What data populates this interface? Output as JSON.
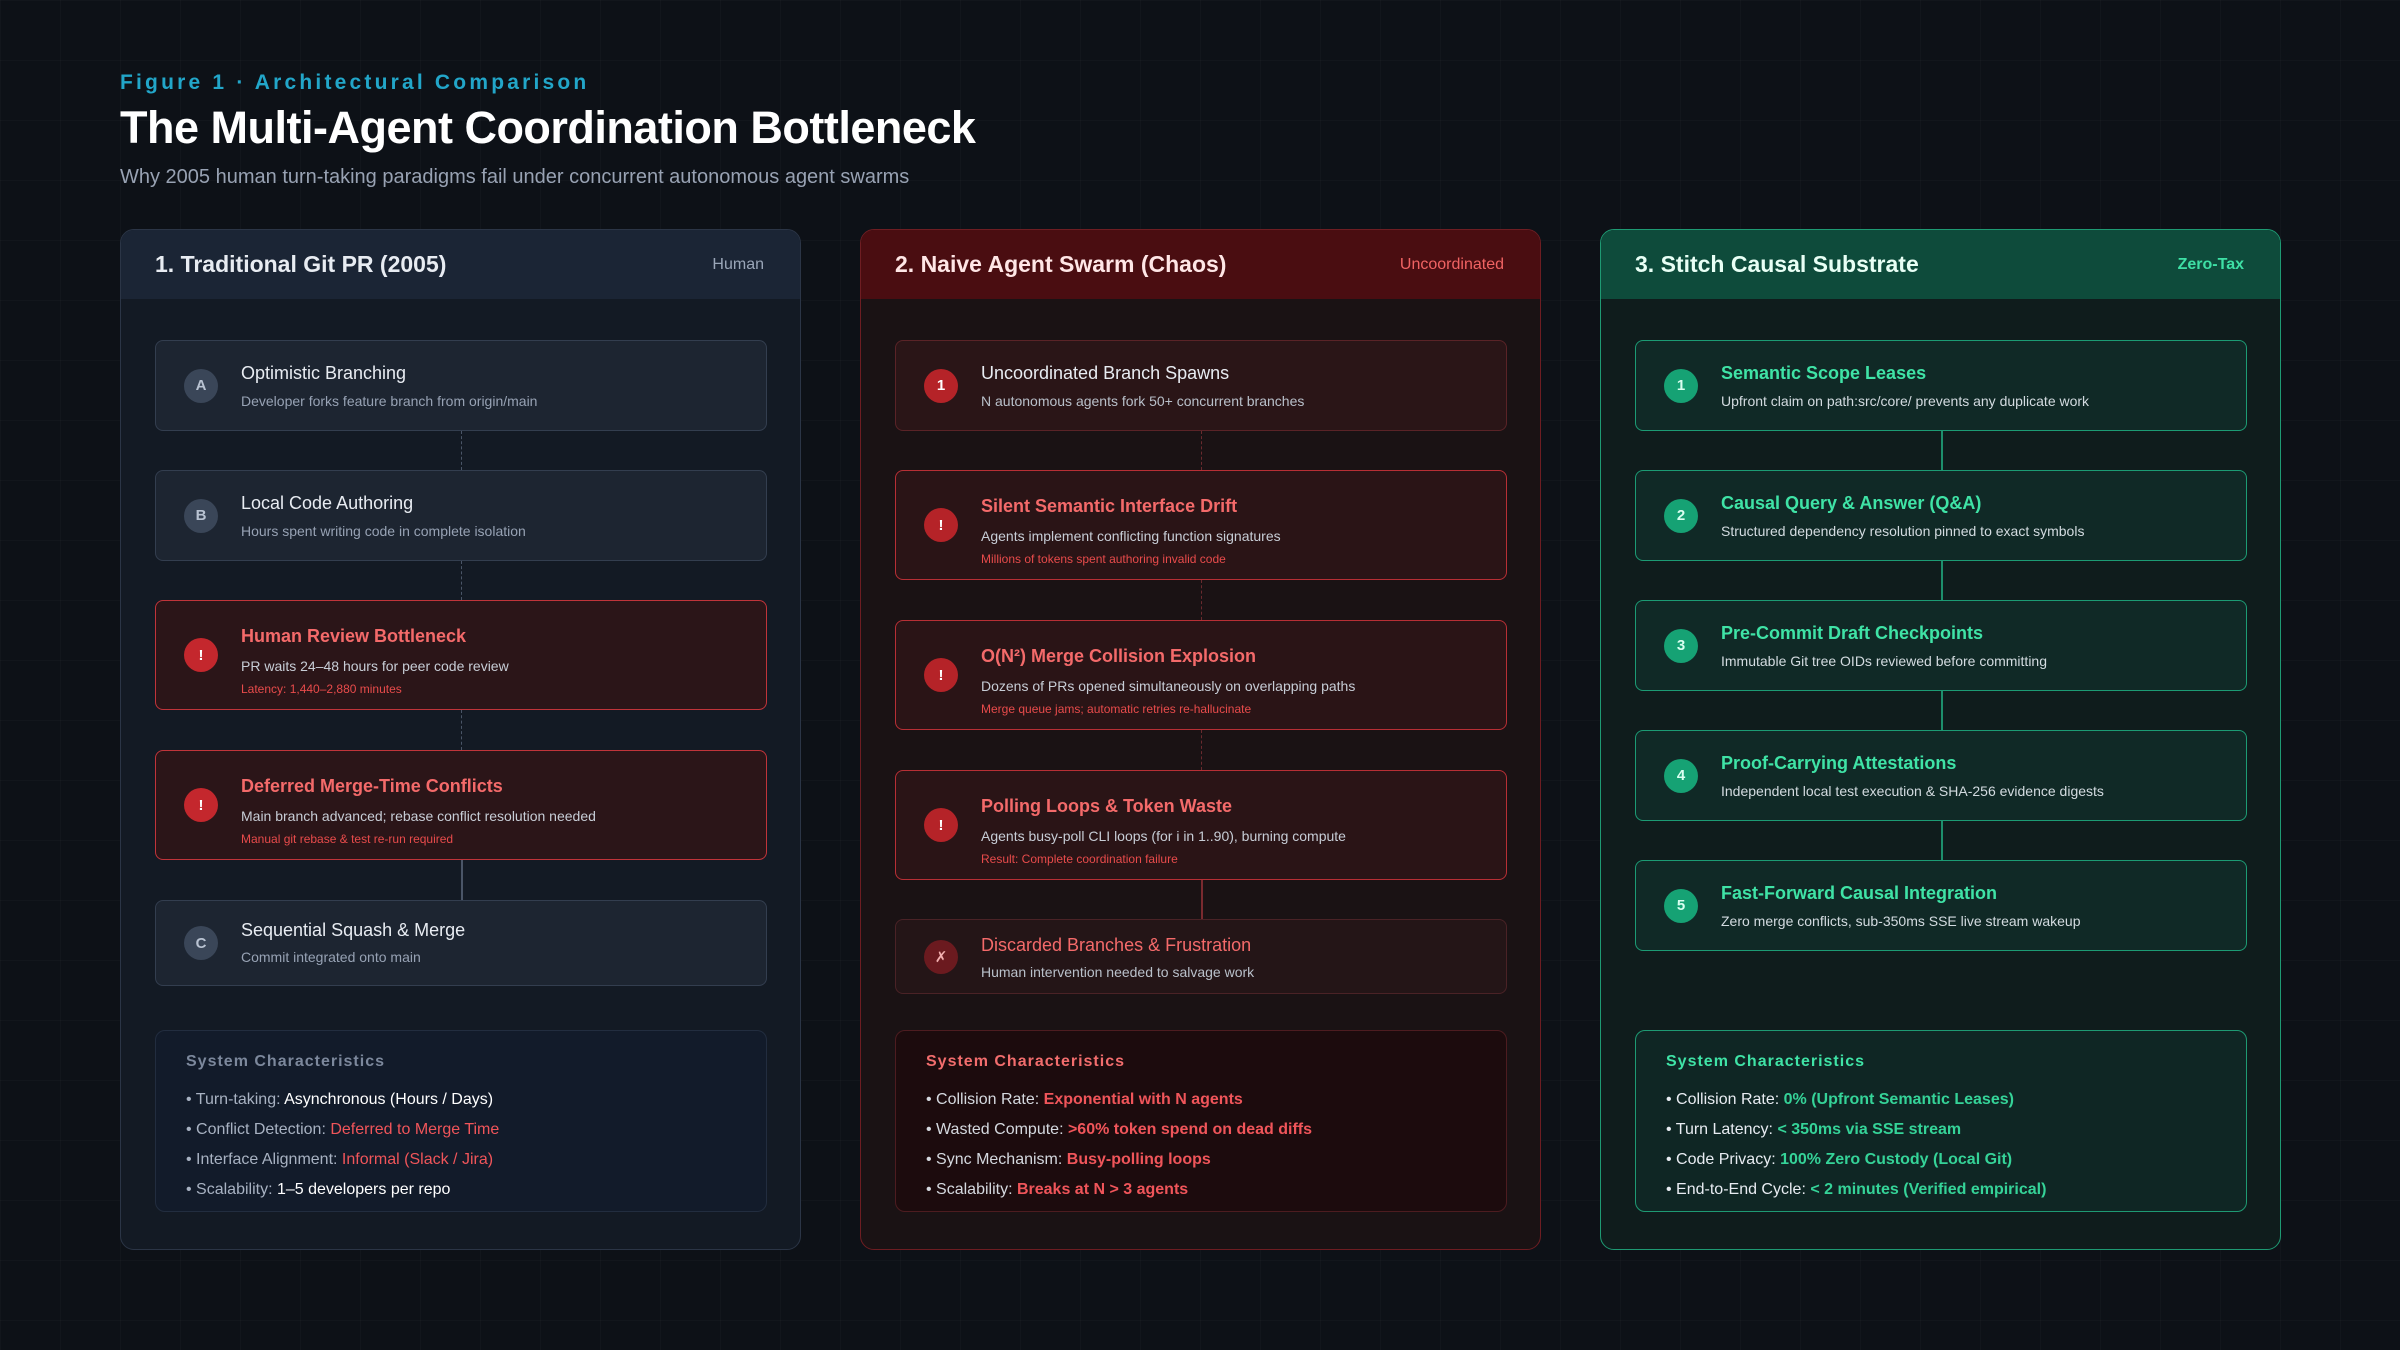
{
  "header": {
    "eyebrow": "Figure 1 · Architectural Comparison",
    "title": "The Multi-Agent Coordination Bottleneck",
    "subtitle": "Why 2005 human turn-taking paradigms fail under concurrent autonomous agent swarms"
  },
  "colors": {
    "accent_cyan": "#22a6c9",
    "alert_red": "#f0555a",
    "success_green": "#35d398"
  },
  "columns": [
    {
      "title": "1. Traditional Git PR (2005)",
      "tag": "Human",
      "steps": [
        {
          "badge": "A",
          "title": "Optimistic Branching",
          "desc": "Developer forks feature branch from origin/main",
          "note": ""
        },
        {
          "badge": "B",
          "title": "Local Code Authoring",
          "desc": "Hours spent writing code in complete isolation",
          "note": ""
        },
        {
          "badge": "!",
          "title": "Human Review Bottleneck",
          "desc": "PR waits 24–48 hours for peer code review",
          "note": "Latency: 1,440–2,880 minutes"
        },
        {
          "badge": "!",
          "title": "Deferred Merge-Time Conflicts",
          "desc": "Main branch advanced; rebase conflict resolution needed",
          "note": "Manual git rebase & test re-run required"
        },
        {
          "badge": "C",
          "title": "Sequential Squash & Merge",
          "desc": "Commit integrated onto main",
          "note": ""
        }
      ],
      "system": {
        "title": "System Characteristics",
        "rows": [
          {
            "label": "• Turn-taking: ",
            "value": "Asynchronous (Hours / Days)"
          },
          {
            "label": "• Conflict Detection: ",
            "value": "Deferred to Merge Time"
          },
          {
            "label": "• Interface Alignment: ",
            "value": "Informal (Slack / Jira)"
          },
          {
            "label": "• Scalability: ",
            "value": "1–5 developers per repo"
          }
        ]
      }
    },
    {
      "title": "2. Naive Agent Swarm (Chaos)",
      "tag": "Uncoordinated",
      "steps": [
        {
          "badge": "1",
          "title": "Uncoordinated Branch Spawns",
          "desc": "N autonomous agents fork 50+ concurrent branches",
          "note": ""
        },
        {
          "badge": "!",
          "title": "Silent Semantic Interface Drift",
          "desc": "Agents implement conflicting function signatures",
          "note": "Millions of tokens spent authoring invalid code"
        },
        {
          "badge": "!",
          "title": "O(N²) Merge Collision Explosion",
          "desc": "Dozens of PRs opened simultaneously on overlapping paths",
          "note": "Merge queue jams; automatic retries re-hallucinate"
        },
        {
          "badge": "!",
          "title": "Polling Loops & Token Waste",
          "desc": "Agents busy-poll CLI loops (for i in 1..90), burning compute",
          "note": "Result: Complete coordination failure"
        },
        {
          "badge": "✗",
          "title": "Discarded Branches & Frustration",
          "desc": "Human intervention needed to salvage work",
          "note": ""
        }
      ],
      "system": {
        "title": "System Characteristics",
        "rows": [
          {
            "label": "• Collision Rate: ",
            "value": "Exponential with N agents"
          },
          {
            "label": "• Wasted Compute: ",
            "value": ">60% token spend on dead diffs"
          },
          {
            "label": "• Sync Mechanism: ",
            "value": "Busy-polling loops"
          },
          {
            "label": "• Scalability: ",
            "value": "Breaks at N > 3 agents"
          }
        ]
      }
    },
    {
      "title": "3. Stitch Causal Substrate",
      "tag": "Zero-Tax",
      "steps": [
        {
          "badge": "1",
          "title": "Semantic Scope Leases",
          "desc": "Upfront claim on path:src/core/ prevents any duplicate work",
          "note": ""
        },
        {
          "badge": "2",
          "title": "Causal Query & Answer (Q&A)",
          "desc": "Structured dependency resolution pinned to exact symbols",
          "note": ""
        },
        {
          "badge": "3",
          "title": "Pre-Commit Draft Checkpoints",
          "desc": "Immutable Git tree OIDs reviewed before committing",
          "note": ""
        },
        {
          "badge": "4",
          "title": "Proof-Carrying Attestations",
          "desc": "Independent local test execution & SHA-256 evidence digests",
          "note": ""
        },
        {
          "badge": "5",
          "title": "Fast-Forward Causal Integration",
          "desc": "Zero merge conflicts, sub-350ms SSE live stream wakeup",
          "note": ""
        }
      ],
      "system": {
        "title": "System Characteristics",
        "rows": [
          {
            "label": "• Collision Rate: ",
            "value": "0% (Upfront Semantic Leases)"
          },
          {
            "label": "• Turn Latency: ",
            "value": "< 350ms via SSE stream"
          },
          {
            "label": "• Code Privacy: ",
            "value": "100% Zero Custody (Local Git)"
          },
          {
            "label": "• End-to-End Cycle: ",
            "value": "< 2 minutes (Verified empirical)"
          }
        ]
      }
    }
  ]
}
